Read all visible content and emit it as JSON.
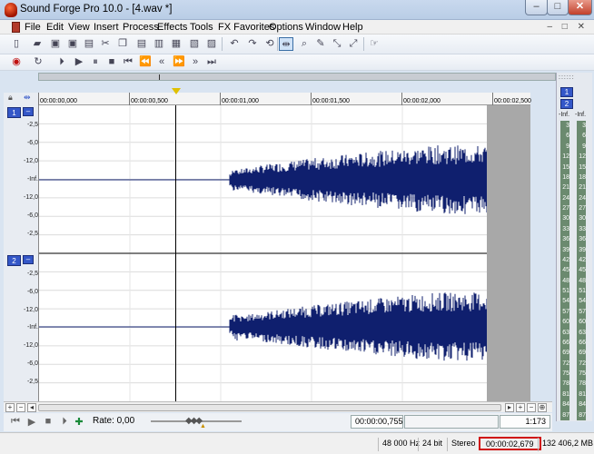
{
  "window": {
    "title": "Sound Forge Pro 10.0 - [4.wav *]"
  },
  "menu": [
    "File",
    "Edit",
    "View",
    "Insert",
    "Process",
    "Effects",
    "Tools",
    "FX Favorites",
    "Options",
    "Window",
    "Help"
  ],
  "ruler": {
    "labels": [
      "00:00:00,000",
      "00:00:00,500",
      "00:00:01,000",
      "00:00:01,500",
      "00:00:02,000",
      "00:00:02,500"
    ]
  },
  "channels": [
    {
      "number": "1",
      "db_labels": [
        "-2,5",
        "-6,0",
        "-12,0",
        "-Inf.",
        "-12,0",
        "-6,0",
        "-2,5"
      ]
    },
    {
      "number": "2",
      "db_labels": [
        "-2,5",
        "-6,0",
        "-12,0",
        "-Inf.",
        "-12,0",
        "-6,0",
        "-2,5"
      ]
    }
  ],
  "meter": {
    "badges": [
      "1",
      "2"
    ],
    "inf_left": "-Inf.",
    "inf_right": "-Inf.",
    "scale": [
      "3",
      "6",
      "9",
      "12",
      "15",
      "18",
      "21",
      "24",
      "27",
      "30",
      "33",
      "36",
      "39",
      "42",
      "45",
      "48",
      "51",
      "54",
      "57",
      "60",
      "63",
      "66",
      "69",
      "72",
      "75",
      "78",
      "81",
      "84",
      "87"
    ]
  },
  "transport": {
    "rate_label": "Rate: 0,00",
    "selection_length": "00:00:00,755",
    "zoom": "1:173"
  },
  "status": {
    "sample_rate": "48 000 Hz",
    "bit_depth": "24 bit",
    "channels": "Stereo",
    "length": "00:00:02,679",
    "disk": "132 406,2 MB"
  },
  "colors": {
    "waveform": "#0f1f6e",
    "channel_badge": "#3457c8",
    "meter": "#6b8a6f",
    "highlight": "#d01010"
  },
  "icons": {
    "toolbar1": [
      "new-icon",
      "open-icon",
      "save-icon",
      "save-as-icon",
      "render-icon",
      "cut-icon",
      "copy-icon",
      "paste-icon",
      "mix-icon",
      "crop-icon",
      "undo-icon",
      "redo-icon",
      "edit-tool-icon",
      "magnify-tool-icon",
      "pencil-tool-icon",
      "envelope-tool-icon",
      "event-tool-icon",
      "properties-icon"
    ],
    "toolbar2": [
      "record-icon",
      "loop-icon",
      "play-all-icon",
      "play-icon",
      "pause-icon",
      "stop-icon",
      "go-start-icon",
      "rewind-icon",
      "forward-icon",
      "go-end-icon"
    ]
  }
}
